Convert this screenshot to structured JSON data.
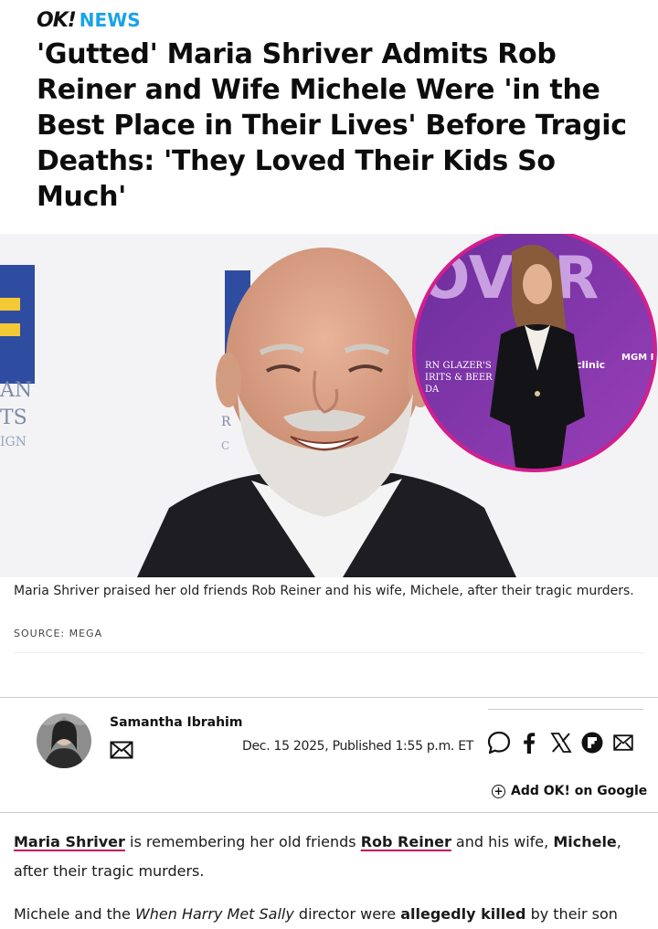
{
  "brand": {
    "logo": "OK!",
    "section": "NEWS"
  },
  "article": {
    "headline": "'Gutted' Maria Shriver Admits Rob Reiner and Wife Michele Were 'in the Best Place in Their Lives' Before Tragic Deaths: 'They Loved Their Kids So Much'",
    "hero_caption": "Maria Shriver praised her old friends Rob Reiner and his wife, Michele, after their tragic murders.",
    "hero_source": "SOURCE: MEGA",
    "hero_backdrop_text": [
      "AN",
      "TS",
      "IGN",
      "RN GLAZER'S",
      "IRITS & BEER",
      "DA",
      "clinic",
      "MGM RE"
    ],
    "author": {
      "name": "Samantha Ibrahim",
      "mail_icon": "envelope-icon"
    },
    "date": "Dec. 15 2025, Published 1:55 p.m. ET",
    "share_icons": [
      "comment-icon",
      "facebook-icon",
      "x-icon",
      "flipboard-icon",
      "mail-icon"
    ],
    "google_cta": "Add OK! on Google",
    "paragraph1": {
      "link1": "Maria Shriver",
      "text1": " is remembering her old friends ",
      "link2": "Rob Reiner",
      "text2": " and his wife, ",
      "bold1": "Michele",
      "text3": ", after their tragic murders."
    },
    "paragraph2": {
      "text1": "Michele and the ",
      "italic1": "When Harry Met Sally",
      "text2": " director were ",
      "bold1": "allegedly killed",
      "text3": " by their son"
    }
  },
  "colors": {
    "accent": "#1aa3e8",
    "link_underline": "#c2185b",
    "circle_border": "#d21f8e"
  }
}
